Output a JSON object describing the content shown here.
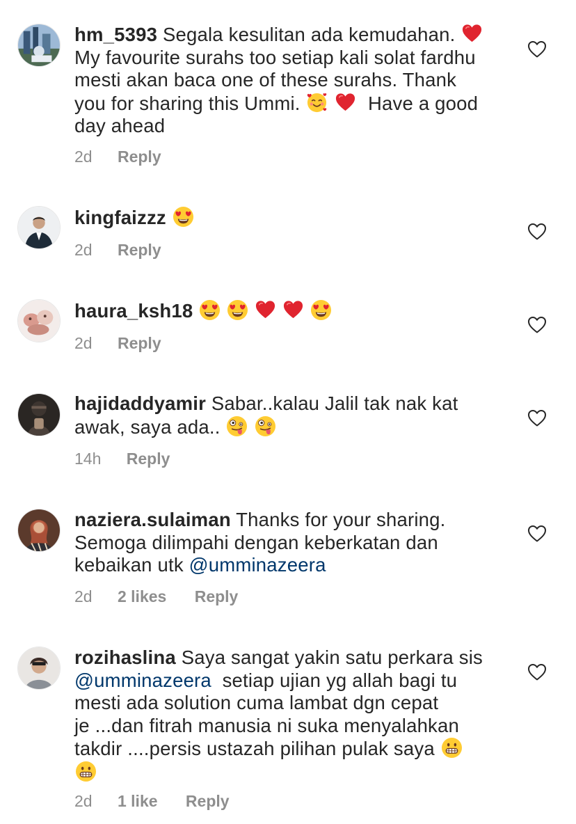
{
  "comments": [
    {
      "username": "hm_5393",
      "text_parts": [
        "Segala kesulitan ada kemudahan. ",
        "\nMy favourite surahs too setiap kali solat fardhu\nmesti akan baca one of these surahs. Thank\nyou for sharing this Ummi. ",
        " ",
        "  Have a good\nday ahead"
      ],
      "time": "2d",
      "likes": "",
      "reply_label": "Reply"
    },
    {
      "username": "kingfaizzz",
      "text_parts": [
        " "
      ],
      "time": "2d",
      "likes": "",
      "reply_label": "Reply"
    },
    {
      "username": "haura_ksh18",
      "text_parts": [
        " "
      ],
      "time": "2d",
      "likes": "",
      "reply_label": "Reply"
    },
    {
      "username": "hajidaddyamir",
      "text_parts": [
        "Sabar..kalau Jalil tak nak kat\nawak, saya ada.. ",
        " "
      ],
      "time": "14h",
      "likes": "",
      "reply_label": "Reply"
    },
    {
      "username": "naziera.sulaiman",
      "text_parts": [
        "Thanks for your sharing.\nSemoga dilimpahi dengan keberkatan dan\nkebaikan utk "
      ],
      "mention": "@umminazeera",
      "time": "2d",
      "likes": "2 likes",
      "reply_label": "Reply"
    },
    {
      "username": "rozihaslina",
      "text_parts": [
        "Saya sangat yakin satu perkara sis\n"
      ],
      "mention": "@umminazeera",
      "text_after": "  setiap ujian yg allah bagi tu\nmesti ada solution cuma lambat dgn cepat\nje ...dan fitrah manusia ni suka menyalahkan\ntakdir ....persis ustazah pilihan pulak saya ",
      "time": "2d",
      "likes": "1 like",
      "reply_label": "Reply"
    }
  ],
  "colors": {
    "text": "#262626",
    "meta": "#8e8e8e",
    "mention": "#00376b",
    "heart_red": "#e0242f"
  },
  "icons": {
    "like": "heart-outline-icon",
    "emoji_red_heart": "red-heart-emoji",
    "emoji_heart_eyes": "heart-eyes-emoji",
    "emoji_smiling_hearts": "smiling-face-with-hearts-emoji",
    "emoji_zany": "zany-face-emoji",
    "emoji_grimace": "grimacing-face-emoji"
  }
}
